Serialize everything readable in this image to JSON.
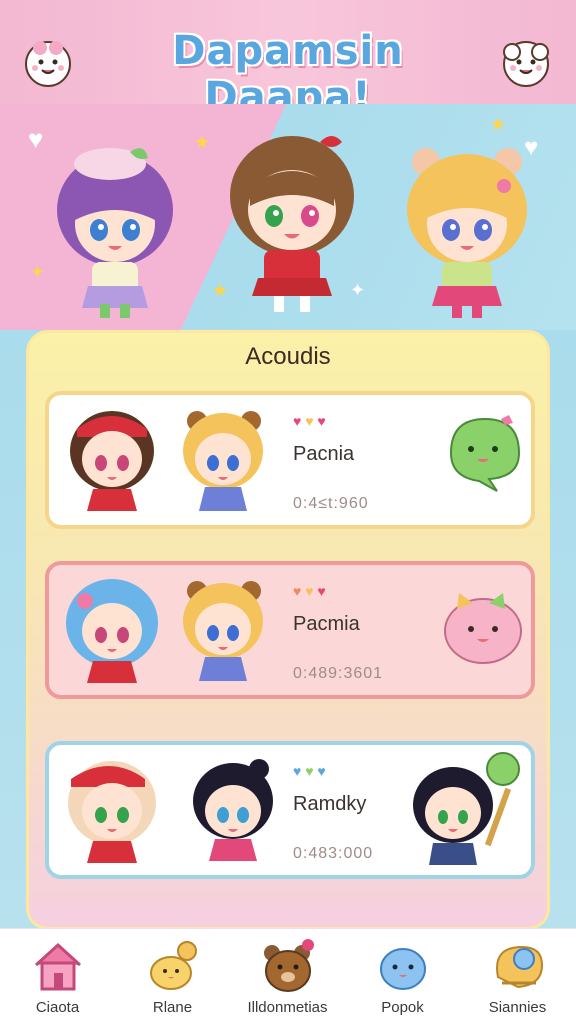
{
  "header": {
    "title": "Dapamsin Daapa!",
    "left_mascot_icon": "smiling-mascot-icon",
    "right_mascot_icon": "smiling-mascot-icon"
  },
  "banner": {
    "characters": [
      "purple-hair-character",
      "brown-hair-character",
      "blonde-bear-ear-character"
    ]
  },
  "section": {
    "title": "Acoudis"
  },
  "cards": [
    {
      "name": "Pacnia",
      "code": "0:4≤t:960",
      "border": "#f4d58a",
      "bg": "#ffffff"
    },
    {
      "name": "Pacmia",
      "code": "0:489:3601",
      "border": "#ef9a9a",
      "bg": "#fbd7d7"
    },
    {
      "name": "Ramdky",
      "code": "0:483:000",
      "border": "#9fd3e6",
      "bg": "#ffffff"
    }
  ],
  "nav": {
    "items": [
      {
        "label": "Ciaota",
        "icon": "house-icon"
      },
      {
        "label": "Rlane",
        "icon": "chick-icon"
      },
      {
        "label": "Illdonmetias",
        "icon": "bear-icon"
      },
      {
        "label": "Popok",
        "icon": "blob-icon"
      },
      {
        "label": "Siannies",
        "icon": "ribbon-icon"
      }
    ]
  },
  "colors": {
    "header_bg": "#f3b8d2",
    "title": "#5aa7e0",
    "panel": "#fbf1a8",
    "nav_bg": "#ffffff"
  }
}
